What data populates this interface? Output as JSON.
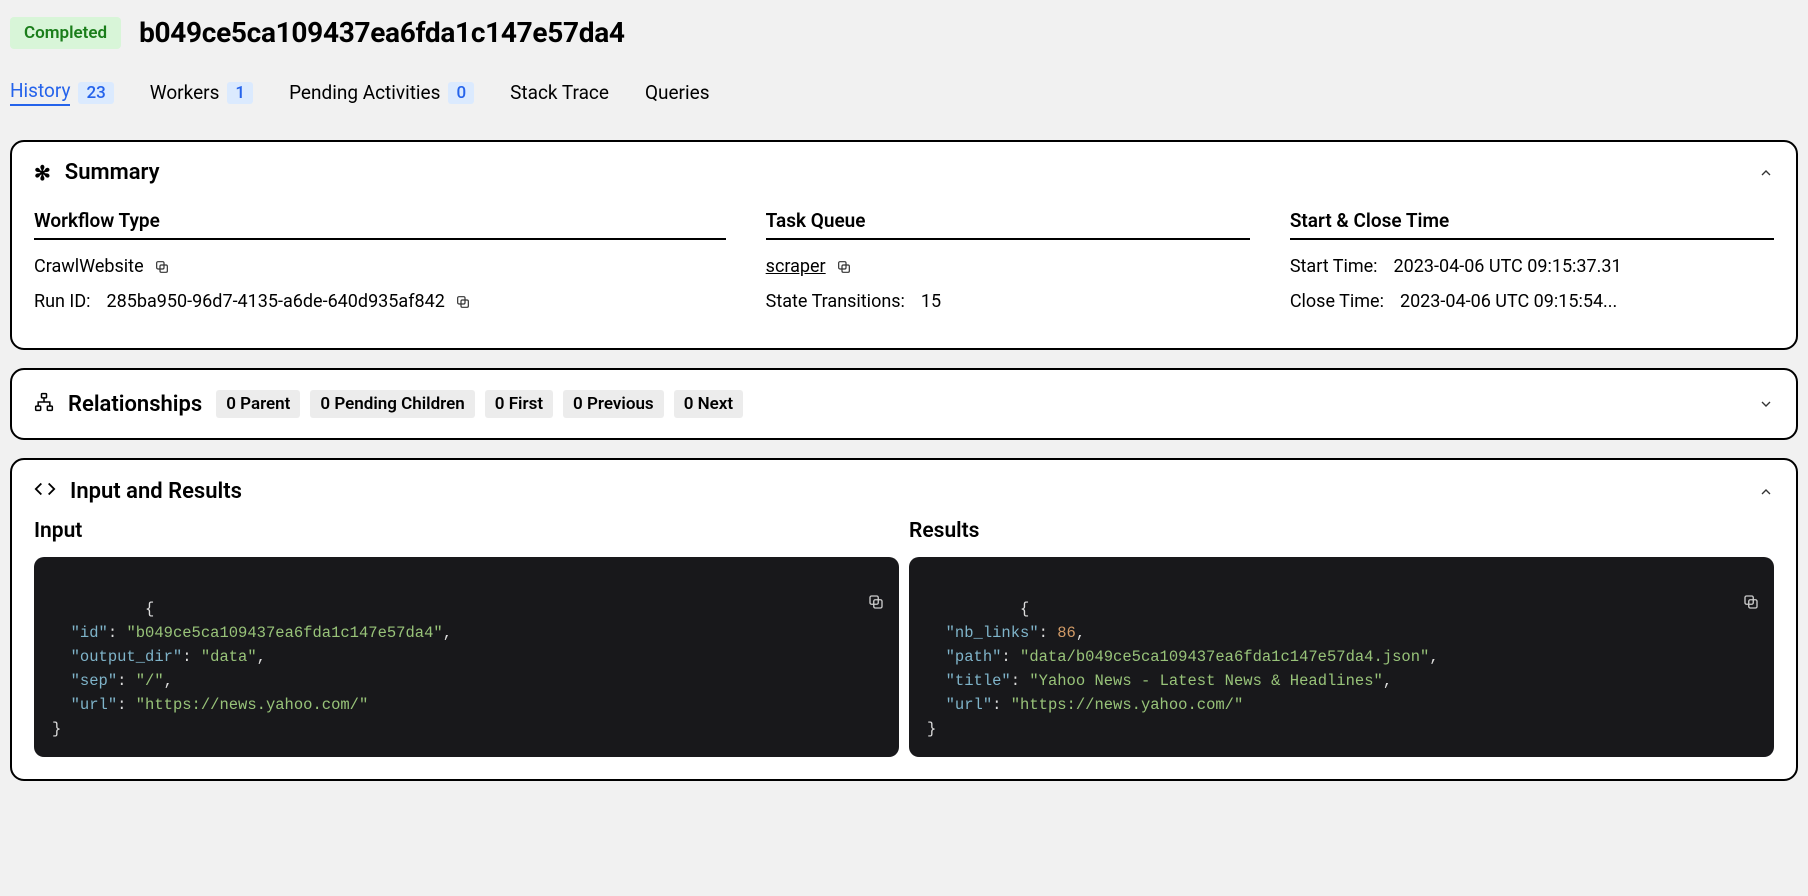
{
  "status": "Completed",
  "workflow_id": "b049ce5ca109437ea6fda1c147e57da4",
  "tabs": {
    "history": {
      "label": "History",
      "count": "23"
    },
    "workers": {
      "label": "Workers",
      "count": "1"
    },
    "pending": {
      "label": "Pending Activities",
      "count": "0"
    },
    "stack": {
      "label": "Stack Trace"
    },
    "queries": {
      "label": "Queries"
    }
  },
  "summary": {
    "title": "Summary",
    "workflow_type_heading": "Workflow Type",
    "workflow_type": "CrawlWebsite",
    "run_id_label": "Run ID:",
    "run_id": "285ba950-96d7-4135-a6de-640d935af842",
    "task_queue_heading": "Task Queue",
    "task_queue": "scraper",
    "state_transitions_label": "State Transitions:",
    "state_transitions": "15",
    "start_close_heading": "Start & Close Time",
    "start_time_label": "Start Time:",
    "start_time": "2023-04-06 UTC 09:15:37.31",
    "close_time_label": "Close Time:",
    "close_time": "2023-04-06 UTC 09:15:54..."
  },
  "relationships": {
    "title": "Relationships",
    "badges": {
      "parent": "0 Parent",
      "pending_children": "0 Pending Children",
      "first": "0 First",
      "previous": "0 Previous",
      "next": "0 Next"
    }
  },
  "io": {
    "title": "Input and Results",
    "input_heading": "Input",
    "results_heading": "Results",
    "input": {
      "id": "b049ce5ca109437ea6fda1c147e57da4",
      "output_dir": "data",
      "sep": "/",
      "url": "https://news.yahoo.com/"
    },
    "results": {
      "nb_links": 86,
      "path": "data/b049ce5ca109437ea6fda1c147e57da4.json",
      "title": "Yahoo News - Latest News & Headlines",
      "url": "https://news.yahoo.com/"
    }
  }
}
